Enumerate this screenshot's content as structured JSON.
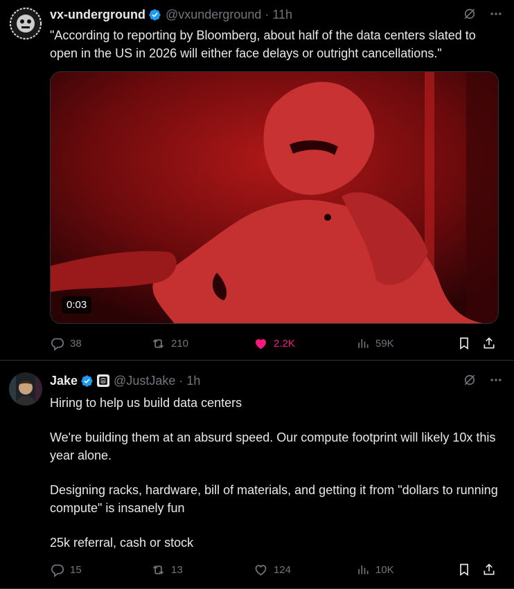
{
  "tweets": [
    {
      "display_name": "vx-underground",
      "handle": "@vxunderground",
      "separator": "·",
      "time": "11h",
      "text": "\"According to reporting by Bloomberg, about half of the data centers slated to open in the US in 2026 will either face delays or outright cancellations.\"",
      "media": {
        "type": "video",
        "duration": "0:03"
      },
      "stats": {
        "replies": "38",
        "reposts": "210",
        "likes": "2.2K",
        "views": "59K"
      },
      "liked": true
    },
    {
      "display_name": "Jake",
      "handle": "@JustJake",
      "separator": "·",
      "time": "1h",
      "paragraphs": [
        "Hiring to help us build data centers",
        "We're building them at an absurd speed. Our compute footprint will likely 10x this year alone.",
        "Designing racks, hardware, bill of materials, and getting it from \"dollars to running compute\" is insanely fun",
        "25k referral, cash or stock"
      ],
      "stats": {
        "replies": "15",
        "reposts": "13",
        "likes": "124",
        "views": "10K"
      },
      "liked": false
    }
  ],
  "colors": {
    "background": "#000000",
    "text": "#e7e9ea",
    "muted": "#71767b",
    "like": "#f91880",
    "verified": "#1d9bf0"
  }
}
